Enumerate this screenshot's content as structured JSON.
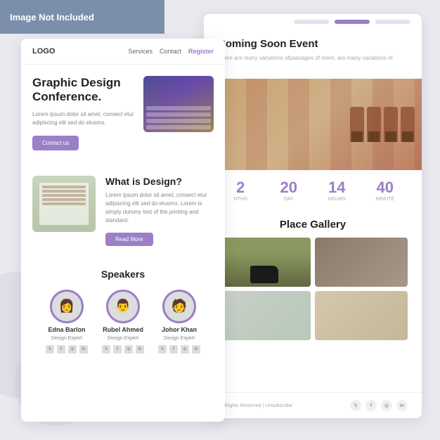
{
  "banner": {
    "text": "Image Not Included"
  },
  "left_card": {
    "nav": {
      "logo": "LOGO",
      "links": [
        "Services",
        "Contact"
      ],
      "register": "Register"
    },
    "hero": {
      "title": "Graphic Design Conference.",
      "description": "Lorem ipsum dolor sit amet, consect etur adipiscing elit sed do elusmo.",
      "button": "Contact us"
    },
    "design": {
      "title": "What is Design?",
      "description": "Lorem ipsum dolor sit amet, consect etur adipiscing elit sed do elusmo. Lorem is simply dummy text of the printing and standard.",
      "button": "Read More"
    },
    "speakers": {
      "title": "Speakers",
      "items": [
        {
          "name": "Edna Barlon",
          "role": "Design Expert",
          "emoji": "👩"
        },
        {
          "name": "Rubel Ahmed",
          "role": "Design Expert",
          "emoji": "👨"
        },
        {
          "name": "Johor Khan",
          "role": "Design Expert",
          "emoji": "🧑"
        }
      ]
    }
  },
  "right_card": {
    "coming_soon": {
      "title": "Coming Soon Event",
      "description": "There are many variations ofpassages of orem. are many variations of"
    },
    "countdown": {
      "items": [
        {
          "number": "2",
          "label": "NTHS"
        },
        {
          "number": "20",
          "label": "DAY"
        },
        {
          "number": "14",
          "label": "HOURS"
        },
        {
          "number": "40",
          "label": "MINUTE"
        }
      ]
    },
    "gallery": {
      "title": "Place Gallery"
    },
    "footer": {
      "text": "All Rights Reserved | Unsubscribe",
      "social_icons": [
        "𝕏",
        "f",
        "◎",
        "in"
      ]
    }
  },
  "colors": {
    "purple": "#9b7fc7",
    "banner_bg": "#7b8faa"
  }
}
